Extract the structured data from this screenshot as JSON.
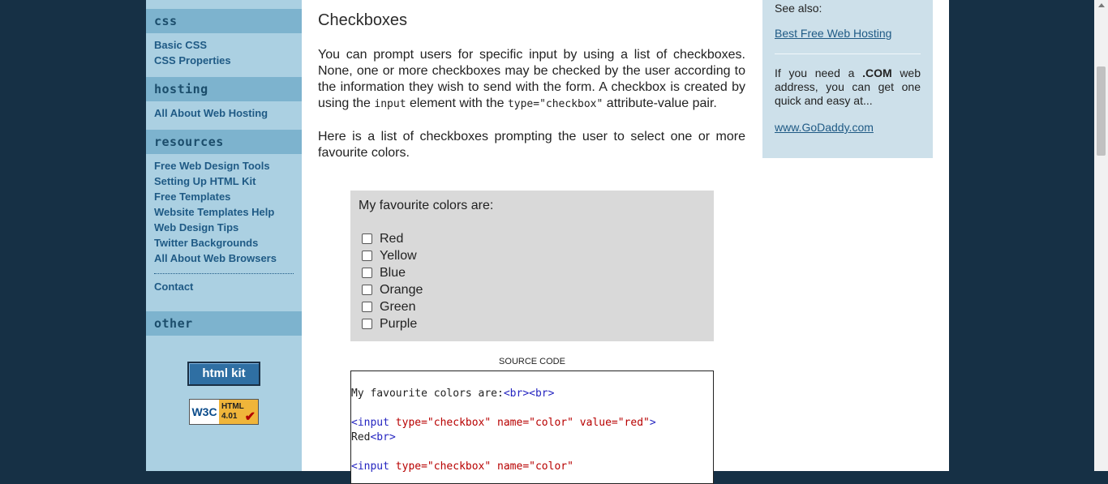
{
  "sidebar": {
    "sections": [
      {
        "title": "css"
      },
      {
        "title": "hosting"
      },
      {
        "title": "resources"
      },
      {
        "title": "other"
      }
    ],
    "css_links": [
      "Basic CSS",
      "CSS Properties"
    ],
    "hosting_links": [
      "All About Web Hosting"
    ],
    "resource_links": [
      "Free Web Design Tools",
      "Setting Up HTML Kit",
      "Free Templates",
      "Website Templates Help",
      "Web Design Tips",
      "Twitter Backgrounds",
      "All About Web Browsers"
    ],
    "contact": "Contact",
    "html_kit_button": "html kit",
    "badge": {
      "w3c": "W3C",
      "html": "HTML",
      "version": "4.01"
    }
  },
  "main": {
    "title": "Checkboxes",
    "p1_a": "You can prompt users for specific input by using a list of checkboxes. None, one or more checkboxes may be checked by the user according to the information they wish to send with the form. A checkbox is created by using the ",
    "p1_code1": "input",
    "p1_b": " element with the ",
    "p1_code2": "type=\"checkbox\"",
    "p1_c": " attribute-value pair.",
    "p2": "Here is a list of checkboxes prompting the user to select one or more favourite colors.",
    "demo_intro": "My favourite colors are:",
    "colors": [
      "Red",
      "Yellow",
      "Blue",
      "Orange",
      "Green",
      "Purple"
    ],
    "source_label": "SOURCE CODE",
    "source": {
      "l1_text": "My favourite colors are:",
      "l1_tags": "<br><br>",
      "l2_open": "<input ",
      "l2_attrs": "type=\"checkbox\" name=\"color\" value=\"red\"",
      "l2_close": ">",
      "l3_text": "Red",
      "l3_tag": "<br>",
      "l4_open": "<input ",
      "l4_attrs": "type=\"checkbox\" name=\"color\""
    }
  },
  "right": {
    "see_also": "See also:",
    "link1": "Best Free Web Hosting",
    "note_a": "If you need a ",
    "note_b": ".COM",
    "note_c": " web address, you can get one quick and easy at...",
    "link2": "www.GoDaddy.com "
  }
}
